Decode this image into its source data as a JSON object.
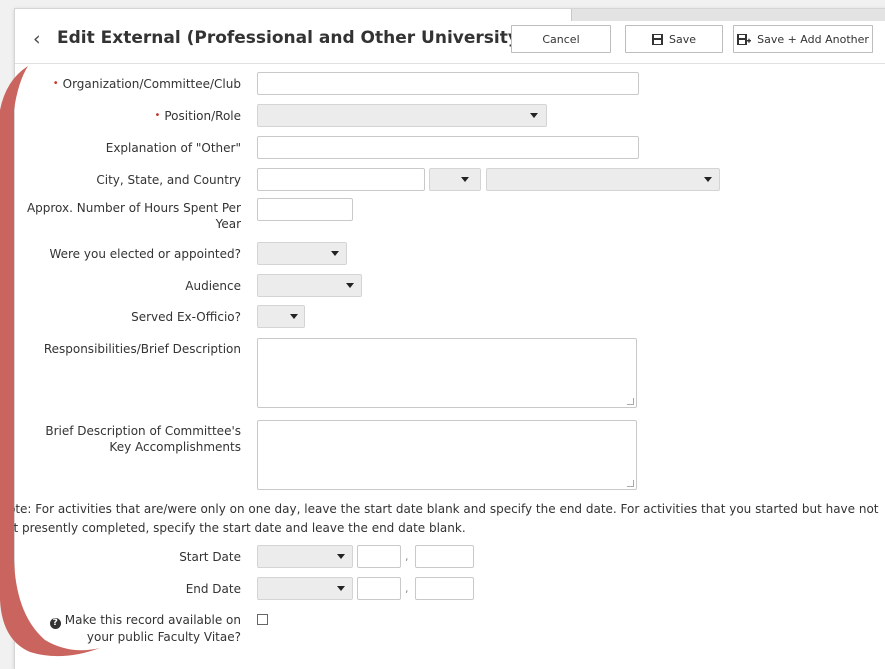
{
  "header": {
    "title": "Edit External (Professional and Other University)",
    "cancel_label": "Cancel",
    "save_label": "Save",
    "save_add_label": "Save + Add Another"
  },
  "form": {
    "org_label": "Organization/Committee/Club",
    "org_value": "",
    "position_label": "Position/Role",
    "explanation_label": "Explanation of \"Other\"",
    "explanation_value": "",
    "city_label": "City, State, and Country",
    "city_value": "",
    "hours_label_1": "Approx. Number of Hours Spent Per",
    "hours_label_2": "Year",
    "hours_value": "",
    "elected_label": "Were you elected or appointed?",
    "audience_label": "Audience",
    "exofficio_label": "Served Ex-Officio?",
    "responsibilities_label": "Responsibilities/Brief Description",
    "accomplishments_label_1": "Brief Description of Committee's",
    "accomplishments_label_2": "Key Accomplishments"
  },
  "note": "Note: For activities that are/were only on one day, leave the start date blank and specify the end date. For activities that you started but have not yet presently completed, specify the start date and leave the end date blank.",
  "dates": {
    "start_label": "Start Date",
    "end_label": "End Date",
    "separator": ","
  },
  "public": {
    "label_1": "Make this record available on",
    "label_2": "your public Faculty Vitae?"
  },
  "colors": {
    "required": "#c0392b",
    "decoration": "#c9655e"
  }
}
